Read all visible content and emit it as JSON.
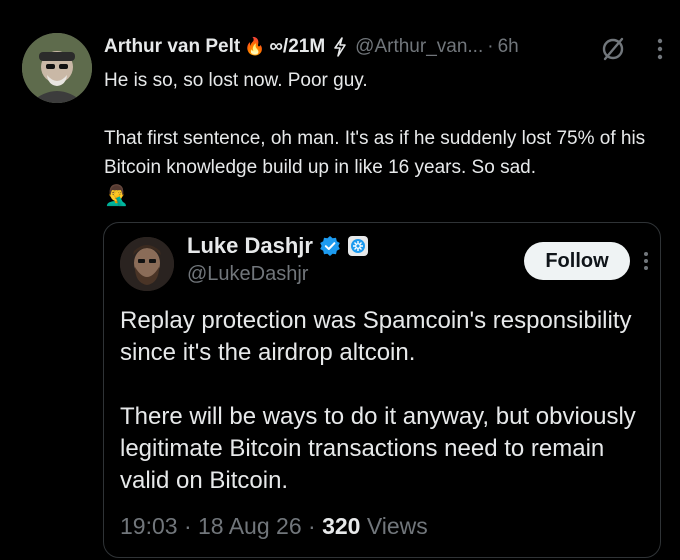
{
  "tweet": {
    "author_name": "Arthur van Pelt",
    "fire_emoji": "🔥",
    "infinity_tag": "∞/21M",
    "handle": "@Arthur_van...",
    "separator": "·",
    "time": "6h",
    "text_line1": "He is so, so lost now. Poor guy.",
    "text_para2": "That first sentence, oh man. It's as if he suddenly lost 75% of his Bitcoin knowledge build up in like 16 years. So sad.",
    "person_emoji": "🤦‍♂️"
  },
  "quote": {
    "author_name": "Luke Dashjr",
    "handle": "@LukeDashjr",
    "follow_label": "Follow",
    "para1": "Replay protection was Spamcoin's responsibility since it's the airdrop altcoin.",
    "para2": "There will be ways to do it anyway, but obviously legitimate Bitcoin transactions need to remain valid on Bitcoin.",
    "time": "19:03",
    "dot": "·",
    "date": "18 Aug 26",
    "views_count": "320",
    "views_label": "Views"
  },
  "icons": {
    "bolt": "lightning-bolt-icon",
    "grok": "grok-slash-icon",
    "more": "more-vertical-icon",
    "verified": "verified-badge-icon",
    "affiliate": "affiliate-badge-icon"
  },
  "colors": {
    "background": "#000000",
    "text": "#e7e9ea",
    "secondary_text": "#71767b",
    "verified_blue": "#1d9bf0",
    "border": "#2f3336",
    "follow_bg": "#eff3f4"
  }
}
